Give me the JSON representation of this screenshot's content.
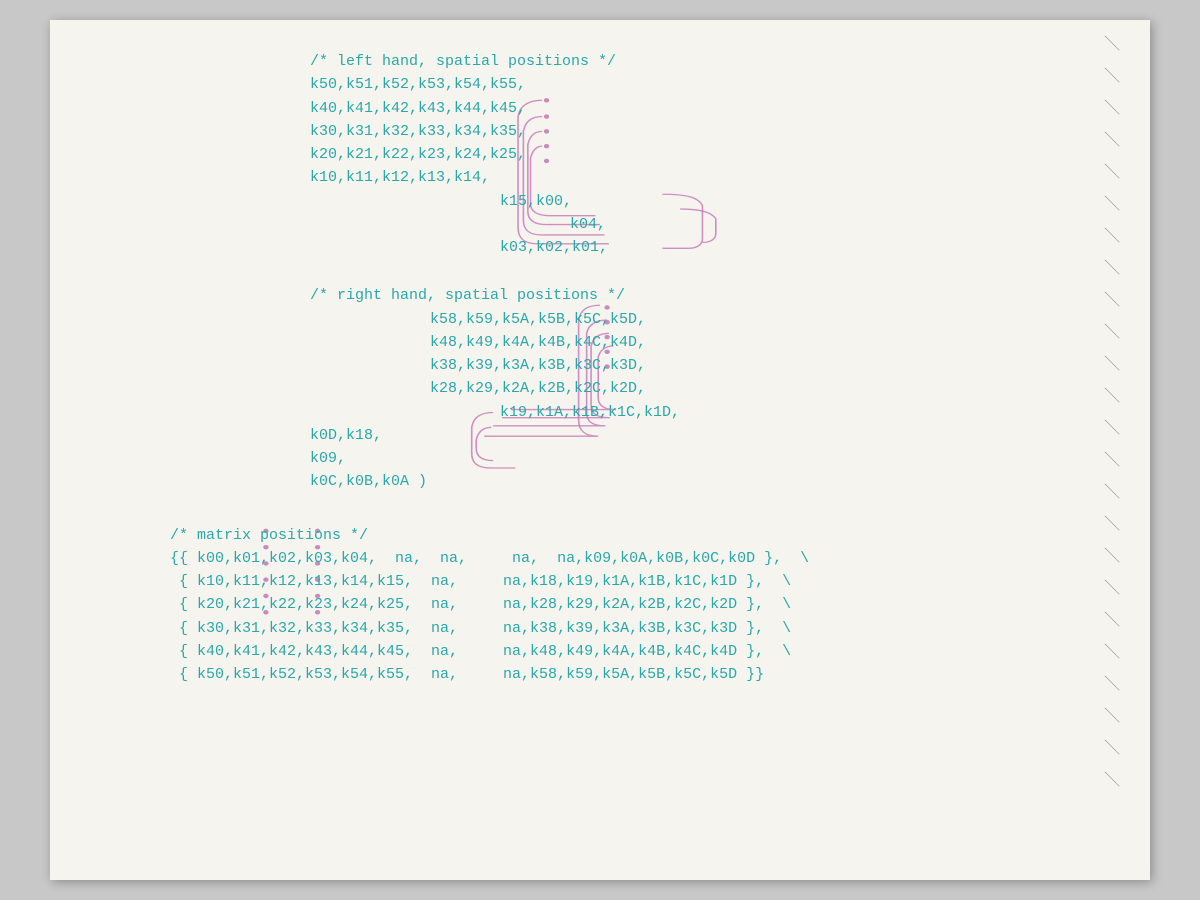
{
  "page": {
    "background": "#f5f4ef",
    "code_color": "#2aa8a8",
    "annotation_color": "#c87db8"
  },
  "left_hand": {
    "comment": "/* left hand, spatial positions */",
    "lines": [
      "k50,k51,k52,k53,k54,k55,",
      "k40,k41,k42,k43,k44,k45,",
      "k30,k31,k32,k33,k34,k35,",
      "k20,k21,k22,k23,k24,k25,",
      "k10,k11,k12,k13,k14,",
      "                              k15,k00,",
      "                                    k04,",
      "                              k03,k02,k01,"
    ]
  },
  "right_hand": {
    "comment": "/* right hand, spatial positions */",
    "lines": [
      "        k58,k59,k5A,k5B,k5C,k5D,",
      "        k48,k49,k4A,k4B,k4C,k4D,",
      "        k38,k39,k3A,k3B,k3C,k3D,",
      "        k28,k29,k2A,k2B,k2C,k2D,",
      "              k19,k1A,k1B,k1C,k1D,",
      "k0D,k18,",
      "k09,",
      "k0C,k0B,k0A )"
    ]
  },
  "matrix": {
    "comment": "/* matrix positions */",
    "lines": [
      "{{ k00,k01,k02,k03,k04,  na,  na,     na,  na,k09,k0A,k0B,k0C,k0D },",
      " { k10,k11,k12,k13,k14,k15,  na,     na,k18,k19,k1A,k1B,k1C,k1D },",
      " { k20,k21,k22,k23,k24,k25,  na,     na,k28,k29,k2A,k2B,k2C,k2D },",
      " { k30,k31,k32,k33,k34,k35,  na,     na,k38,k39,k3A,k3B,k3C,k3D },",
      " { k40,k41,k42,k43,k44,k45,  na,     na,k48,k49,k4A,k4B,k4C,k4D },",
      " { k50,k51,k52,k53,k54,k55,  na,     na,k58,k59,k5A,k5B,k5C,k5D }}"
    ]
  }
}
